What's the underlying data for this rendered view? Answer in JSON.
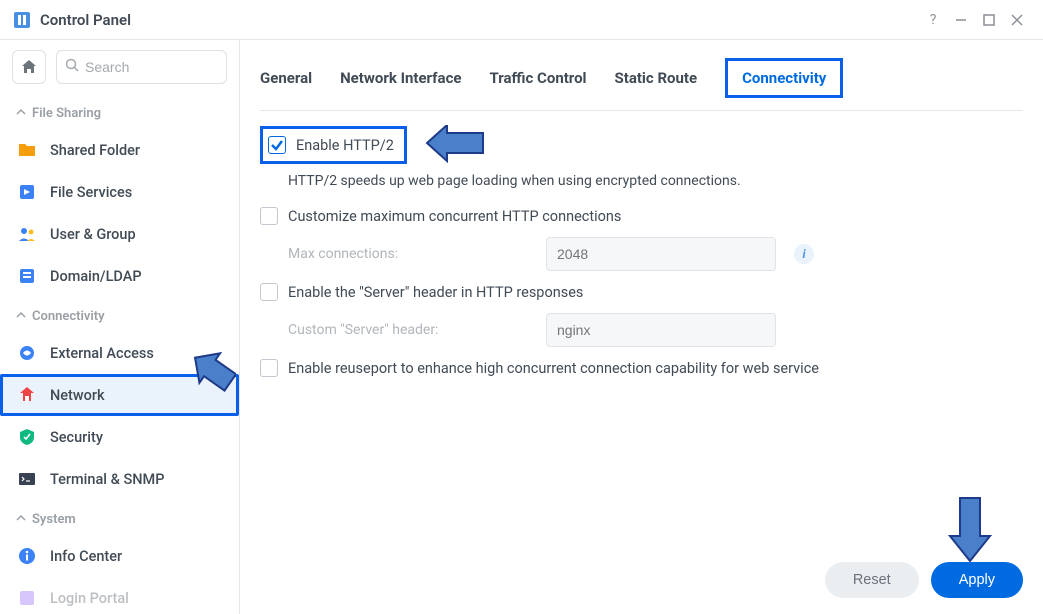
{
  "title": "Control Panel",
  "search": {
    "placeholder": "Search"
  },
  "sections": {
    "file_sharing": "File Sharing",
    "connectivity": "Connectivity",
    "system": "System"
  },
  "sidebar": {
    "shared_folder": "Shared Folder",
    "file_services": "File Services",
    "user_group": "User & Group",
    "domain_ldap": "Domain/LDAP",
    "external_access": "External Access",
    "network": "Network",
    "security": "Security",
    "terminal_snmp": "Terminal & SNMP",
    "info_center": "Info Center",
    "login_portal": "Login Portal"
  },
  "tabs": {
    "general": "General",
    "network_interface": "Network Interface",
    "traffic_control": "Traffic Control",
    "static_route": "Static Route",
    "connectivity": "Connectivity"
  },
  "form": {
    "enable_http2": "Enable HTTP/2",
    "http2_desc": "HTTP/2 speeds up web page loading when using encrypted connections.",
    "customize_max": "Customize maximum concurrent HTTP connections",
    "max_conn_label": "Max connections:",
    "max_conn_value": "2048",
    "enable_server_header": "Enable the \"Server\" header in HTTP responses",
    "custom_header_label": "Custom \"Server\" header:",
    "custom_header_value": "nginx",
    "enable_reuseport": "Enable reuseport to enhance high concurrent connection capability for web service"
  },
  "buttons": {
    "reset": "Reset",
    "apply": "Apply"
  }
}
